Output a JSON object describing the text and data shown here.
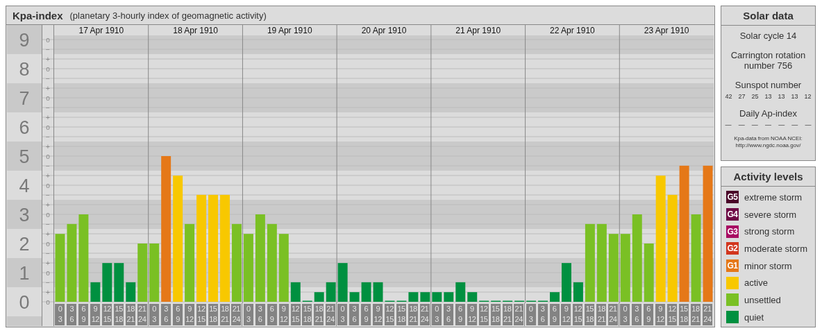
{
  "panel": {
    "title": "Kpa-index",
    "subtitle": "(planetary 3-hourly index of geomagnetic activity)"
  },
  "y_axis": [
    {
      "value": "9",
      "marks": [
        "o",
        "−"
      ]
    },
    {
      "value": "8",
      "marks": [
        "+",
        "o",
        "−"
      ]
    },
    {
      "value": "7",
      "marks": [
        "+",
        "o",
        "−"
      ]
    },
    {
      "value": "6",
      "marks": [
        "+",
        "o",
        "−"
      ]
    },
    {
      "value": "5",
      "marks": [
        "+",
        "o",
        "−"
      ]
    },
    {
      "value": "4",
      "marks": [
        "+",
        "o",
        "−"
      ]
    },
    {
      "value": "3",
      "marks": [
        "+",
        "o",
        "−"
      ]
    },
    {
      "value": "2",
      "marks": [
        "+",
        "o",
        "−"
      ]
    },
    {
      "value": "1",
      "marks": [
        "+",
        "o",
        "−"
      ]
    },
    {
      "value": "0",
      "marks": [
        "+",
        "o"
      ]
    }
  ],
  "days": [
    {
      "date": "17 Apr 1910"
    },
    {
      "date": "18 Apr 1910"
    },
    {
      "date": "19 Apr 1910"
    },
    {
      "date": "20 Apr 1910"
    },
    {
      "date": "21 Apr 1910"
    },
    {
      "date": "22 Apr 1910"
    },
    {
      "date": "23 Apr 1910"
    }
  ],
  "chart_data": {
    "type": "bar",
    "stacked": true,
    "grid": true,
    "ylim": [
      0,
      9.5
    ],
    "yticks": [
      0,
      1,
      2,
      3,
      4,
      5,
      6,
      7,
      8,
      9
    ],
    "categories": [
      "0\n3",
      "3\n6",
      "6\n9",
      "9\n12",
      "12\n15",
      "15\n18",
      "18\n21",
      "21\n24",
      "0\n3",
      "3\n6",
      "6\n9",
      "9\n12",
      "12\n15",
      "15\n18",
      "18\n21",
      "21\n24",
      "0\n3",
      "3\n6",
      "6\n9",
      "9\n12",
      "12\n15",
      "15\n18",
      "18\n21",
      "21\n24",
      "0\n3",
      "3\n6",
      "6\n9",
      "9\n12",
      "12\n15",
      "15\n18",
      "18\n21",
      "21\n24",
      "0\n3",
      "3\n6",
      "6\n9",
      "9\n12",
      "12\n15",
      "15\n18",
      "18\n21",
      "21\n24",
      "0\n3",
      "3\n6",
      "6\n9",
      "9\n12",
      "12\n15",
      "15\n18",
      "18\n21",
      "21\n24",
      "0\n3",
      "3\n6",
      "6\n9",
      "9\n12",
      "12\n15",
      "15\n18",
      "18\n21",
      "21\n24"
    ],
    "series": [
      {
        "color": "#009040",
        "values": [
          null,
          null,
          null,
          0.67,
          1.33,
          1.33,
          0.67,
          null,
          null,
          null,
          null,
          null,
          null,
          null,
          null,
          null,
          null,
          null,
          null,
          null,
          0.67,
          0,
          0.33,
          0.67,
          1.33,
          0.33,
          0.67,
          0.67,
          0,
          0,
          0.33,
          0.33,
          0.33,
          0.33,
          0.67,
          0.33,
          0,
          0,
          0,
          0,
          0,
          0,
          0.33,
          1.33,
          0.67,
          null,
          null,
          null,
          null,
          null,
          null,
          null,
          null,
          null,
          null,
          null
        ]
      },
      {
        "color": "#7ac024",
        "values": [
          2.33,
          2.67,
          3,
          null,
          null,
          null,
          null,
          2,
          2,
          null,
          null,
          2.67,
          null,
          null,
          null,
          2.67,
          2.33,
          3,
          2.67,
          2.33,
          null,
          null,
          null,
          null,
          null,
          null,
          null,
          null,
          null,
          null,
          null,
          null,
          null,
          null,
          null,
          null,
          null,
          null,
          null,
          null,
          null,
          null,
          null,
          null,
          null,
          2.67,
          2.67,
          2.33,
          2.33,
          3,
          2,
          null,
          null,
          null,
          3,
          null
        ]
      },
      {
        "color": "#f8c800",
        "values": [
          null,
          null,
          null,
          null,
          null,
          null,
          null,
          null,
          null,
          null,
          4.33,
          null,
          3.67,
          3.67,
          3.67,
          null,
          null,
          null,
          null,
          null,
          null,
          null,
          null,
          null,
          null,
          null,
          null,
          null,
          null,
          null,
          null,
          null,
          null,
          null,
          null,
          null,
          null,
          null,
          null,
          null,
          null,
          null,
          null,
          null,
          null,
          null,
          null,
          null,
          null,
          null,
          null,
          4.33,
          3.67,
          null,
          null,
          null
        ]
      },
      {
        "color": "#e57818",
        "values": [
          null,
          null,
          null,
          null,
          null,
          null,
          null,
          null,
          null,
          5,
          null,
          null,
          null,
          null,
          null,
          null,
          null,
          null,
          null,
          null,
          null,
          null,
          null,
          null,
          null,
          null,
          null,
          null,
          null,
          null,
          null,
          null,
          null,
          null,
          null,
          null,
          null,
          null,
          null,
          null,
          null,
          null,
          null,
          null,
          null,
          null,
          null,
          null,
          null,
          null,
          null,
          null,
          null,
          4.67,
          null,
          4.67
        ]
      }
    ]
  },
  "solar_data": {
    "title": "Solar data",
    "solar_cycle": "Solar cycle 14",
    "carrington": "Carrington rotation number 756",
    "sunspot_title": "Sunspot number",
    "sunspots": [
      "42",
      "27",
      "25",
      "13",
      "13",
      "13",
      "12"
    ],
    "ap_title": "Daily Ap-index",
    "ap_values": [
      "—",
      "—",
      "—",
      "—",
      "—",
      "—",
      "—"
    ],
    "source": "Kpa-data from NOAA NCEI:",
    "source_url": "http://www.ngdc.noaa.gov/"
  },
  "activity_levels": {
    "title": "Activity levels",
    "items": [
      {
        "badge": "G5",
        "label": "extreme storm",
        "color": "#4a0428"
      },
      {
        "badge": "G4",
        "label": "severe storm",
        "color": "#6e0a44"
      },
      {
        "badge": "G3",
        "label": "strong storm",
        "color": "#a80c62"
      },
      {
        "badge": "G2",
        "label": "moderate storm",
        "color": "#d2361e"
      },
      {
        "badge": "G1",
        "label": "minor storm",
        "color": "#e57818"
      },
      {
        "label": "active",
        "color": "#f8c800"
      },
      {
        "label": "unsettled",
        "color": "#7ac024"
      },
      {
        "label": "quiet",
        "color": "#009040"
      }
    ]
  }
}
